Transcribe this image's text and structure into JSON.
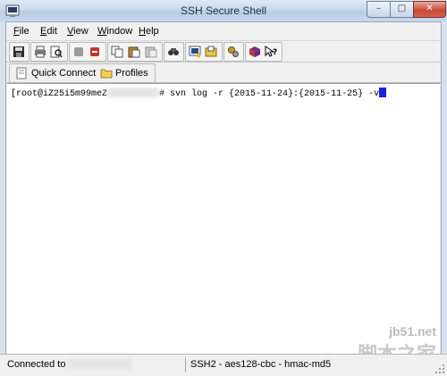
{
  "window": {
    "title": "SSH Secure Shell",
    "controls": {
      "minimize": "–",
      "maximize": "□",
      "close": "✕"
    }
  },
  "menu": {
    "items": [
      {
        "label": "File",
        "mnemonic": "F",
        "rest": "ile"
      },
      {
        "label": "Edit",
        "mnemonic": "E",
        "rest": "dit"
      },
      {
        "label": "View",
        "mnemonic": "V",
        "rest": "iew"
      },
      {
        "label": "Window",
        "mnemonic": "W",
        "rest": "indow"
      },
      {
        "label": "Help",
        "mnemonic": "H",
        "rest": "elp"
      }
    ]
  },
  "toolbar": {
    "icons": [
      "save-icon",
      "print-icon",
      "print-preview-icon",
      "disconnect-icon",
      "connect-icon",
      "copy-icon",
      "paste-icon",
      "paste-disabled-icon",
      "find-icon",
      "new-terminal-icon",
      "new-file-transfer-icon",
      "settings-icon",
      "help-book-icon",
      "whats-this-icon"
    ]
  },
  "quickbar": {
    "quick_connect_label": "Quick Connect",
    "profiles_label": "Profiles"
  },
  "terminal": {
    "prompt_user": "[root@iZ25i5m99meZ",
    "prompt_end": "# svn log -r {2015-11-24}:{2015-11-25} -v",
    "cursor_text": "v"
  },
  "statusbar": {
    "connection_label": "Connected to",
    "cipher_info": "SSH2 - aes128-cbc - hmac-md5"
  },
  "watermark": {
    "top": "jb51.net",
    "bottom": "脚本之家"
  },
  "colors": {
    "terminal_bg": "#ffffff",
    "cursor": "#1a20e0",
    "close_button": "#c74b3a"
  }
}
